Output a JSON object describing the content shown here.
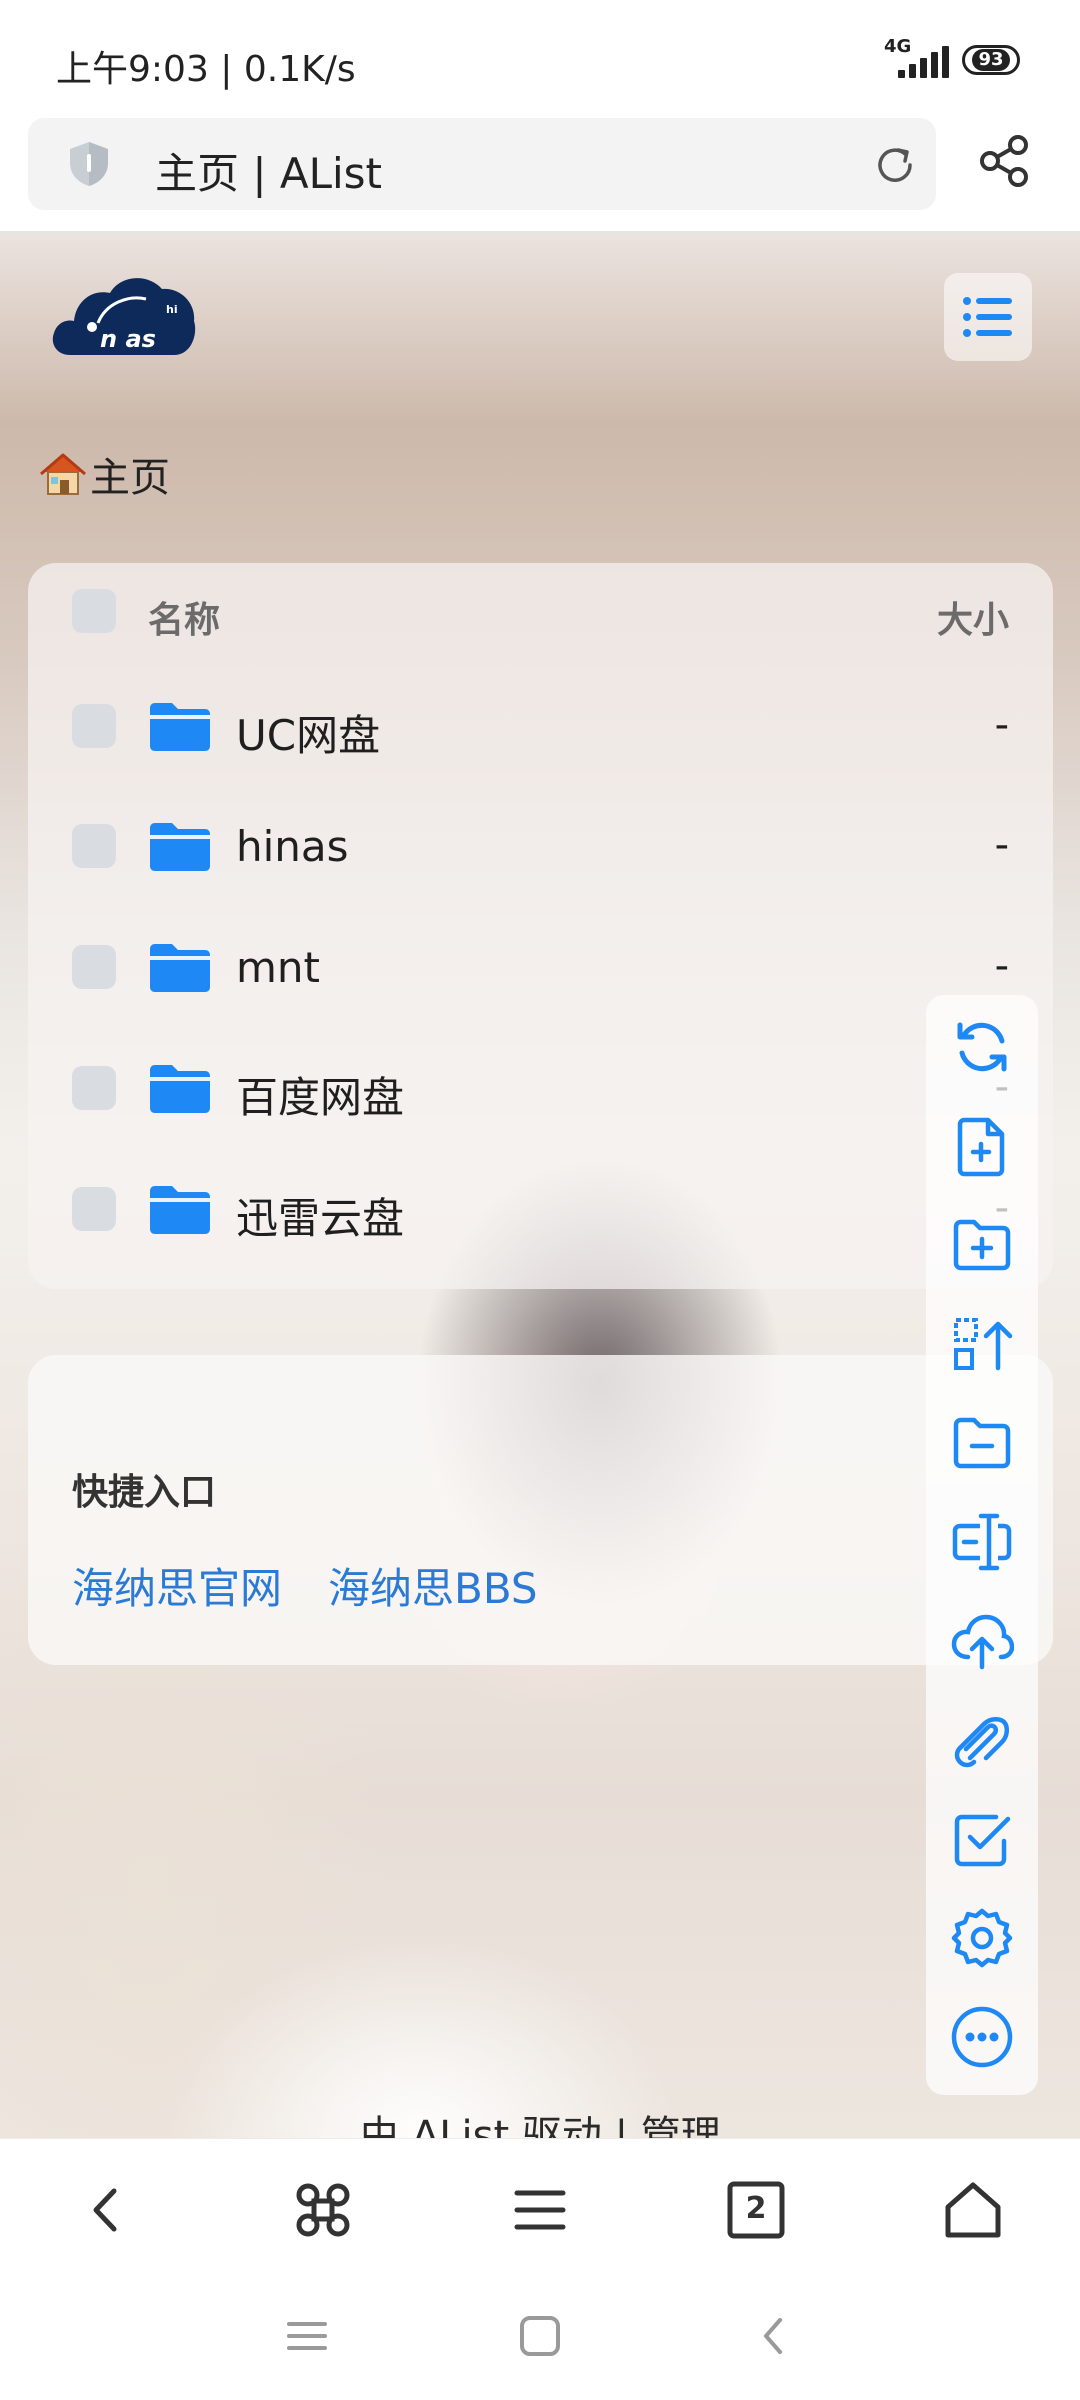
{
  "status_bar": {
    "time": "上午9:03 | 0.1K/s",
    "network": "4G",
    "battery": "93"
  },
  "address_bar": {
    "title": "主页 | AList",
    "icons": [
      "shield-icon",
      "reload-icon",
      "share-icon"
    ]
  },
  "header": {
    "logo_text": "n as",
    "logo_small": "hi",
    "menu_icon": "list-icon"
  },
  "breadcrumb": {
    "label": "主页",
    "icon": "house-icon"
  },
  "file_list": {
    "header": {
      "name": "名称",
      "size": "大小"
    },
    "rows": [
      {
        "name": "UC网盘",
        "size": "-"
      },
      {
        "name": "hinas",
        "size": "-"
      },
      {
        "name": "mnt",
        "size": "-"
      },
      {
        "name": "百度网盘",
        "size": "-"
      },
      {
        "name": "迅雷云盘",
        "size": "-"
      }
    ]
  },
  "quick_access": {
    "title": "快捷入口",
    "links": [
      "海纳思官网",
      "海纳思BBS"
    ]
  },
  "footer": {
    "text": "由 AList 驱动 | 管理"
  },
  "side_toolbar": [
    "refresh-icon",
    "new-file-icon",
    "new-folder-icon",
    "upload-select-icon",
    "folder-minus-icon",
    "rename-icon",
    "cloud-upload-icon",
    "link-icon",
    "checkbox-icon",
    "settings-icon",
    "more-icon"
  ],
  "bottom_nav": {
    "tab_count": "2",
    "icons": [
      "back-icon",
      "command-icon",
      "menu-icon",
      "tabs-icon",
      "home-icon"
    ]
  },
  "gesture_bar": [
    "recents-icon",
    "home-gesture-icon",
    "back-gesture-icon"
  ],
  "colors": {
    "accent": "#1e88f5",
    "link": "#2a7ad6",
    "logo": "#0e2a5a"
  }
}
